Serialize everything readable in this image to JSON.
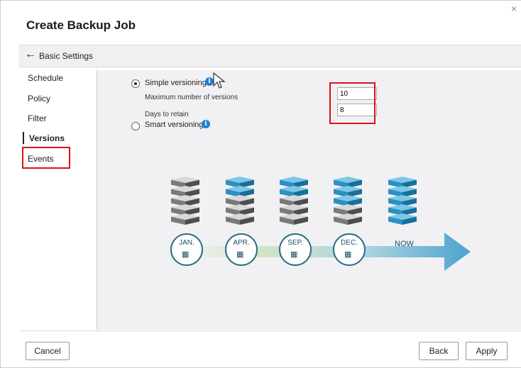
{
  "dialog": {
    "title": "Create Backup Job",
    "close_label": "×"
  },
  "back": {
    "label": "Basic Settings"
  },
  "sidebar": {
    "items": [
      {
        "label": "Schedule"
      },
      {
        "label": "Policy"
      },
      {
        "label": "Filter"
      },
      {
        "label": "Versions"
      },
      {
        "label": "Events"
      }
    ]
  },
  "versioning": {
    "simple_label": "Simple versioning",
    "max_versions_label": "Maximum number of versions",
    "max_versions_value": "10",
    "days_label": "Days to retain",
    "days_value": "8",
    "smart_label": "Smart versioning"
  },
  "timeline": {
    "labels": [
      "JAN.",
      "APR.",
      "SEP.",
      "DEC."
    ],
    "now_label": "NOW"
  },
  "footer": {
    "cancel": "Cancel",
    "back": "Back",
    "apply": "Apply"
  }
}
